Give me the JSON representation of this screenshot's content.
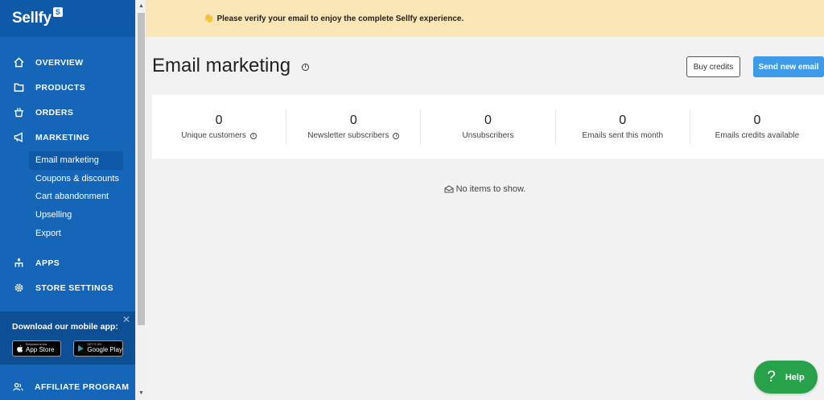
{
  "brand": {
    "name": "Sellfy",
    "badge": "S"
  },
  "sidebar": {
    "items": [
      {
        "label": "OVERVIEW",
        "icon": "home-icon"
      },
      {
        "label": "PRODUCTS",
        "icon": "folder-icon"
      },
      {
        "label": "ORDERS",
        "icon": "basket-icon"
      },
      {
        "label": "MARKETING",
        "icon": "megaphone-icon"
      }
    ],
    "marketing_sub": [
      {
        "label": "Email marketing",
        "active": true
      },
      {
        "label": "Coupons & discounts"
      },
      {
        "label": "Cart abandonment"
      },
      {
        "label": "Upselling"
      },
      {
        "label": "Export"
      }
    ],
    "apps_label": "APPS",
    "settings_label": "STORE SETTINGS",
    "promo": {
      "title": "Download our mobile app:",
      "close": "✕",
      "app_store_small": "Download on the",
      "app_store_big": "App Store",
      "google_small": "GET IT ON",
      "google_big": "Google Play"
    },
    "affiliate_label": "AFFILIATE PROGRAM"
  },
  "banner": {
    "icon": "👋",
    "text": "Please verify your email to enjoy the complete Sellfy experience."
  },
  "page": {
    "title": "Email marketing",
    "info": "i",
    "buy_credits": "Buy credits",
    "send_new_email": "Send new email"
  },
  "stats": [
    {
      "value": "0",
      "label": "Unique customers"
    },
    {
      "value": "0",
      "label": "Newsletter subscribers"
    },
    {
      "value": "0",
      "label": "Unsubscribers"
    },
    {
      "value": "0",
      "label": "Emails sent this month"
    },
    {
      "value": "0",
      "label": "Emails credits available"
    }
  ],
  "empty_state": "No items to show.",
  "help": {
    "q": "?",
    "label": "Help"
  },
  "colors": {
    "sidebar": "#1565b8",
    "primary_button": "#3d9be9",
    "help": "#27a24a",
    "banner": "#fbe6b8"
  }
}
